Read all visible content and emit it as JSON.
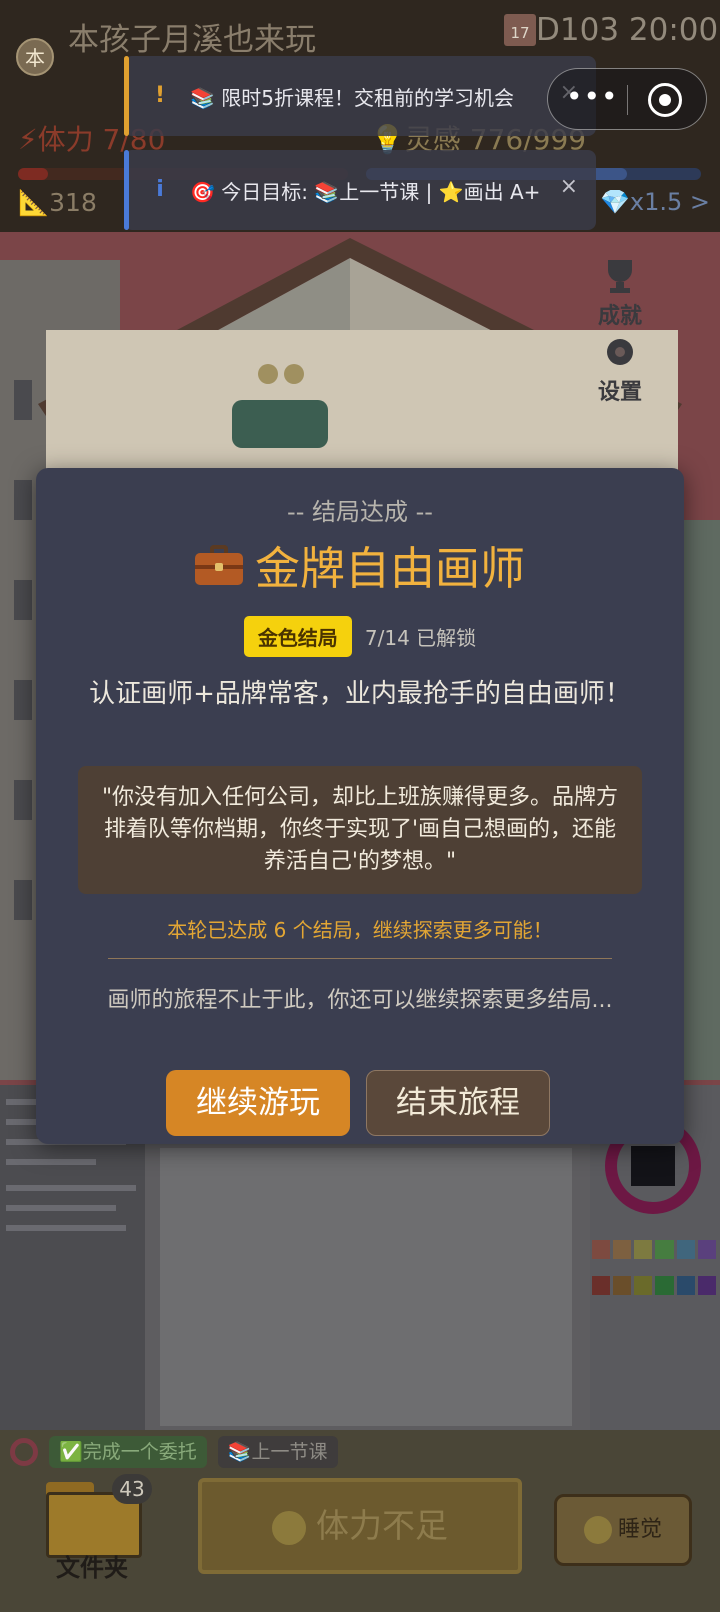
{
  "hud": {
    "avatar_initial": "本",
    "player_name": "本孩子月溪也来玩",
    "calendar_month": "17",
    "day_time": "D103 20:00",
    "stamina_label": "⚡体力 7/80",
    "stamina_fraction": 0.09,
    "inspiration_label": "💡灵感 776/999",
    "inspiration_fraction": 0.78,
    "skill_value": "📐318",
    "gem_rate": "💎x1.5 >"
  },
  "side_buttons": {
    "achievements": "成就",
    "settings": "设置"
  },
  "toasts": [
    {
      "type": "warning",
      "icon": "!",
      "text": "📚 限时5折课程！交租前的学习机会",
      "color": "#e0a030"
    },
    {
      "type": "info",
      "icon": "i",
      "text": "🎯 今日目标: 📚上一节课 | ⭐画出 A+",
      "color": "#4a7ad8"
    }
  ],
  "capsule": {
    "menu_glyph": "•••"
  },
  "modal": {
    "kicker": "-- 结局达成 --",
    "title": "金牌自由画师",
    "badge": "金色结局",
    "unlock_count": "7/14 已解锁",
    "description": "认证画师+品牌常客，业内最抢手的自由画师！",
    "quote": "\"你没有加入任何公司，却比上班族赚得更多。品牌方排着队等你档期，你终于实现了'画自己想画的，还能养活自己'的梦想。\"",
    "note": "本轮已达成 6 个结局，继续探索更多可能！",
    "journey": "画师的旅程不止于此，你还可以继续探索更多结局...",
    "btn_continue": "继续游玩",
    "btn_end": "结束旅程"
  },
  "bottom": {
    "goal_done": "✅完成一个委托",
    "goal_class": "📚上一节课",
    "folder_count": "43",
    "folder_label": "文件夹",
    "main_action": "体力不足",
    "sleep_label": "睡觉"
  },
  "colors": {
    "accent_gold": "#f2b23e",
    "button_orange": "#d68625",
    "badge_yellow": "#f5d10d",
    "modal_bg": "#3b3e50"
  }
}
